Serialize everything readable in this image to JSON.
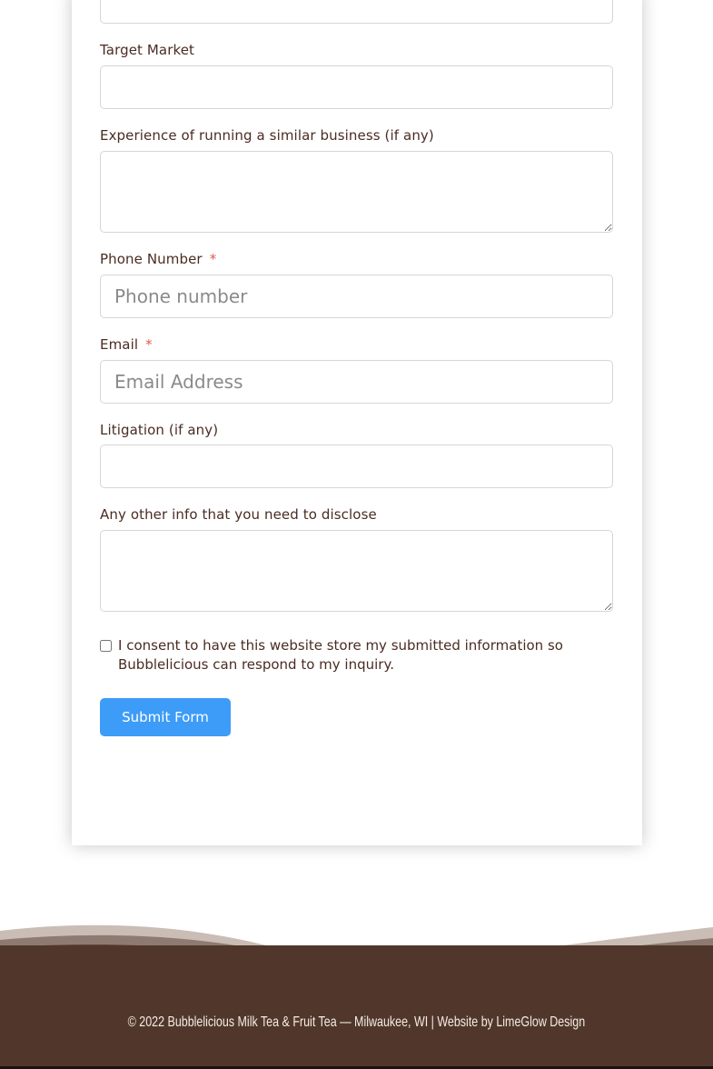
{
  "form": {
    "fields": [
      {
        "label": "Target Market",
        "placeholder": "",
        "required": false
      },
      {
        "label": "Experience of running a similar business (if any)",
        "placeholder": "",
        "required": false
      },
      {
        "label": "Phone Number",
        "placeholder": "Phone number",
        "required": true
      },
      {
        "label": "Email",
        "placeholder": "Email Address",
        "required": true
      },
      {
        "label": "Litigation (if any)",
        "placeholder": "",
        "required": false
      },
      {
        "label": "Any other info that you need to disclose",
        "placeholder": "",
        "required": false
      }
    ],
    "required_marker": "*",
    "consent_text": "I consent to have this website store my submitted information so Bubblelicious can respond to my inquiry.",
    "consent_checked": false,
    "submit_label": "Submit Form"
  },
  "footer": {
    "text": "© 2022 Bubblelicious Milk Tea & Fruit Tea — Milwaukee, WI  |  Website by LimeGlow Design"
  },
  "colors": {
    "label_text": "#4a2c22",
    "required_marker": "#e05a4e",
    "submit_button": "#3d9cf7",
    "footer_bg": "#51372b",
    "footer_wave_light": "#c9bdb6",
    "footer_wave_mid": "#8e7a70"
  }
}
